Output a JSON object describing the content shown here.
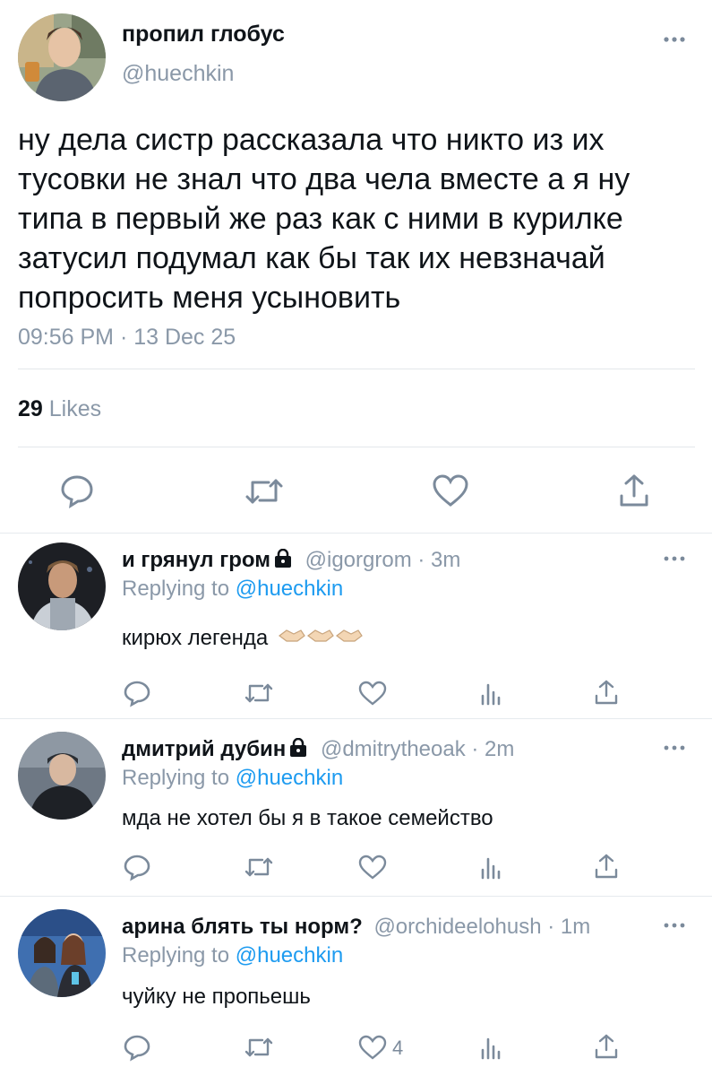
{
  "main_tweet": {
    "display_name": "пропил глобус",
    "handle": "@huechkin",
    "text": "ну дела систр рассказала что никто из их тусовки не знал что два чела вместе а я ну типа в первый же раз как с ними в курилке затусил подумал как бы так их невзначай попросить меня усыновить",
    "timestamp": "09:56 PM · 13 Dec 25",
    "likes_count": "29",
    "likes_label": "Likes"
  },
  "replies": [
    {
      "display_name": "и грянул гром",
      "handle": "@igorgrom",
      "time": "· 3m",
      "replying_prefix": "Replying to",
      "replying_to": "@huechkin",
      "text": "кирюх легенда",
      "emoji": "handshake",
      "like_count": ""
    },
    {
      "display_name": "дмитрий дубин",
      "handle": "@dmitrytheoak",
      "time": "· 2m",
      "replying_prefix": "Replying to",
      "replying_to": "@huechkin",
      "text": "мда не хотел бы я в такое семейство",
      "like_count": ""
    },
    {
      "display_name": "арина блять ты норм?",
      "handle": "@orchideelohush",
      "time": "· 1m",
      "replying_prefix": "Replying to",
      "replying_to": "@huechkin",
      "text": "чуйку не пропьешь",
      "like_count": "4"
    }
  ],
  "colors": {
    "link": "#1d9bf0",
    "muted": "#8a98a8",
    "icon": "#7b8a9b",
    "divider": "#e6eaee"
  },
  "icons": [
    "reply-icon",
    "retweet-icon",
    "like-icon",
    "share-icon",
    "analytics-icon",
    "more-icon",
    "lock-icon",
    "handshake-emoji"
  ]
}
